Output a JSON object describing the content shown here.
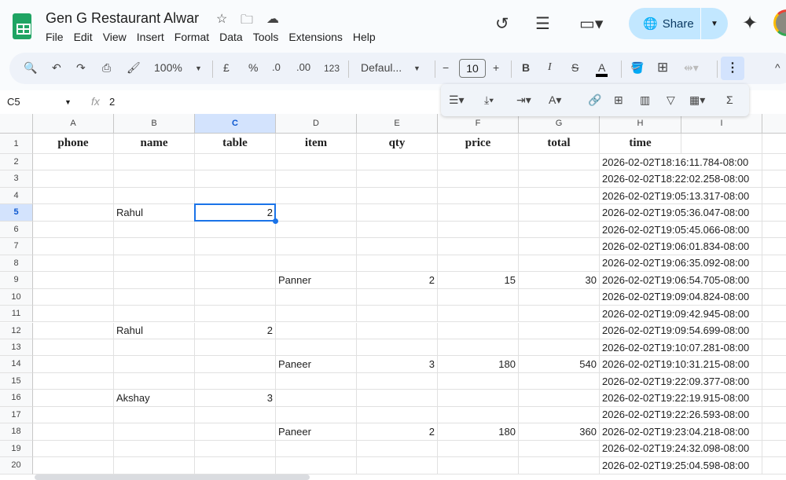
{
  "app": {
    "title": "Gen G Restaurant Alwar",
    "menu": [
      "File",
      "Edit",
      "View",
      "Insert",
      "Format",
      "Data",
      "Tools",
      "Extensions",
      "Help"
    ],
    "share_label": "Share"
  },
  "toolbar": {
    "zoom": "100%",
    "currency": "£",
    "percent": "%",
    "dec_decrease": ".0",
    "dec_increase": ".00",
    "number_format": "123",
    "font": "Defaul...",
    "font_size": "10"
  },
  "formula_bar": {
    "name_box": "C5",
    "fx": "fx",
    "value": "2"
  },
  "grid": {
    "columns": [
      "A",
      "B",
      "C",
      "D",
      "E",
      "F",
      "G",
      "H",
      "I"
    ],
    "selected_column": "C",
    "selected_row": 5,
    "headers": [
      "phone",
      "name",
      "table",
      "item",
      "qty",
      "price",
      "total",
      "time"
    ],
    "rows": [
      [
        "",
        "",
        "",
        "",
        "",
        "",
        "",
        "2026-02-02T18:16:11.784-08:00"
      ],
      [
        "",
        "",
        "",
        "",
        "",
        "",
        "",
        "2026-02-02T18:22:02.258-08:00"
      ],
      [
        "",
        "",
        "",
        "",
        "",
        "",
        "",
        "2026-02-02T19:05:13.317-08:00"
      ],
      [
        "",
        "Rahul",
        "2",
        "",
        "",
        "",
        "",
        "2026-02-02T19:05:36.047-08:00"
      ],
      [
        "",
        "",
        "",
        "",
        "",
        "",
        "",
        "2026-02-02T19:05:45.066-08:00"
      ],
      [
        "",
        "",
        "",
        "",
        "",
        "",
        "",
        "2026-02-02T19:06:01.834-08:00"
      ],
      [
        "",
        "",
        "",
        "",
        "",
        "",
        "",
        "2026-02-02T19:06:35.092-08:00"
      ],
      [
        "",
        "",
        "",
        "Panner",
        "2",
        "15",
        "30",
        "2026-02-02T19:06:54.705-08:00"
      ],
      [
        "",
        "",
        "",
        "",
        "",
        "",
        "",
        "2026-02-02T19:09:04.824-08:00"
      ],
      [
        "",
        "",
        "",
        "",
        "",
        "",
        "",
        "2026-02-02T19:09:42.945-08:00"
      ],
      [
        "",
        "Rahul",
        "2",
        "",
        "",
        "",
        "",
        "2026-02-02T19:09:54.699-08:00"
      ],
      [
        "",
        "",
        "",
        "",
        "",
        "",
        "",
        "2026-02-02T19:10:07.281-08:00"
      ],
      [
        "",
        "",
        "",
        "Paneer",
        "3",
        "180",
        "540",
        "2026-02-02T19:10:31.215-08:00"
      ],
      [
        "",
        "",
        "",
        "",
        "",
        "",
        "",
        "2026-02-02T19:22:09.377-08:00"
      ],
      [
        "",
        "Akshay",
        "3",
        "",
        "",
        "",
        "",
        "2026-02-02T19:22:19.915-08:00"
      ],
      [
        "",
        "",
        "",
        "",
        "",
        "",
        "",
        "2026-02-02T19:22:26.593-08:00"
      ],
      [
        "",
        "",
        "",
        "Paneer",
        "2",
        "180",
        "360",
        "2026-02-02T19:23:04.218-08:00"
      ],
      [
        "",
        "",
        "",
        "",
        "",
        "",
        "",
        "2026-02-02T19:24:32.098-08:00"
      ],
      [
        "",
        "",
        "",
        "",
        "",
        "",
        "",
        "2026-02-02T19:25:04.598-08:00"
      ]
    ]
  }
}
